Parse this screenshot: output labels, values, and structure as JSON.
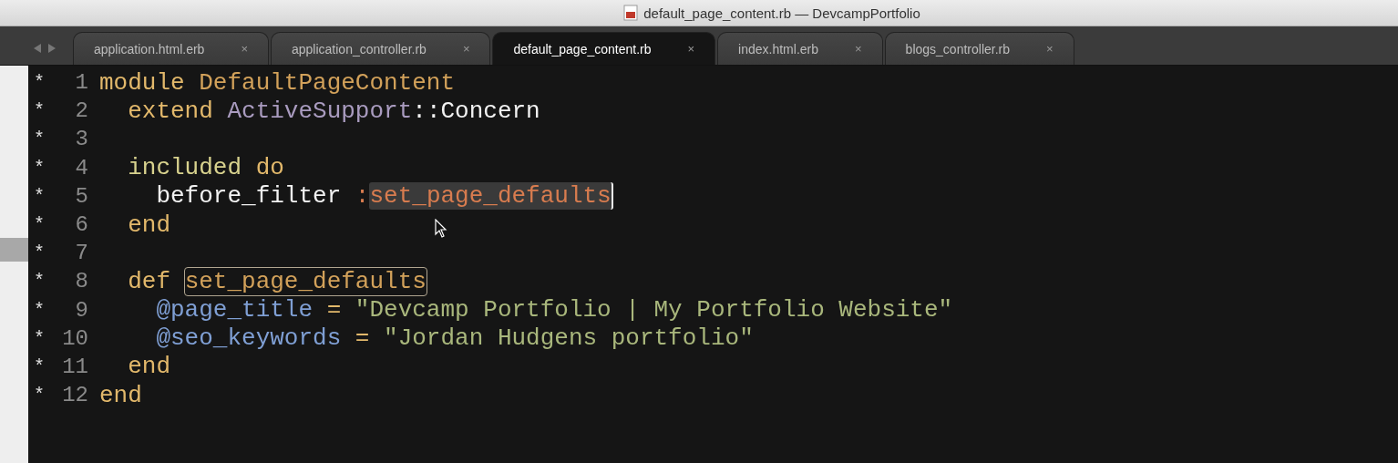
{
  "window": {
    "title": "default_page_content.rb — DevcampPortfolio"
  },
  "tabs": [
    {
      "label": "application.html.erb",
      "close": "×",
      "selected": false
    },
    {
      "label": "application_controller.rb",
      "close": "×",
      "selected": false
    },
    {
      "label": "default_page_content.rb",
      "close": "×",
      "selected": true
    },
    {
      "label": "index.html.erb",
      "close": "×",
      "selected": false
    },
    {
      "label": "blogs_controller.rb",
      "close": "×",
      "selected": false
    }
  ],
  "editor": {
    "lines": [
      {
        "marker": "*",
        "number": "1",
        "tokens": [
          {
            "kind": "keyword",
            "text": "module "
          },
          {
            "kind": "constant",
            "text": "DefaultPageContent"
          }
        ]
      },
      {
        "marker": "*",
        "number": "2",
        "tokens": [
          {
            "kind": "keyword",
            "text": "  extend "
          },
          {
            "kind": "module",
            "text": "ActiveSupport"
          },
          {
            "kind": "plain",
            "text": "::Concern"
          }
        ]
      },
      {
        "marker": "*",
        "number": "3"
      },
      {
        "marker": "*",
        "number": "4",
        "tokens": [
          {
            "kind": "method",
            "text": "  included "
          },
          {
            "kind": "keyword",
            "text": "do"
          }
        ]
      },
      {
        "marker": "*",
        "number": "5",
        "tokens": [
          {
            "kind": "plain",
            "text": "    before_filter "
          },
          {
            "kind": "symbol",
            "text": ":"
          },
          {
            "kind": "symbol",
            "text": "set_page_defaults",
            "selected": true
          }
        ]
      },
      {
        "marker": "*",
        "number": "6",
        "tokens": [
          {
            "kind": "keyword",
            "text": "  end"
          }
        ]
      },
      {
        "marker": "*",
        "number": "7"
      },
      {
        "marker": "*",
        "number": "8",
        "tokens": [
          {
            "kind": "keyword",
            "text": "  def "
          },
          {
            "kind": "constant",
            "text": "set_page_defaults",
            "boxed": true
          }
        ]
      },
      {
        "marker": "*",
        "number": "9",
        "tokens": [
          {
            "kind": "ivar",
            "text": "    @page_title"
          },
          {
            "kind": "keyword",
            "text": " = "
          },
          {
            "kind": "string",
            "text": "\"Devcamp Portfolio | My Portfolio Website\""
          }
        ]
      },
      {
        "marker": "*",
        "number": "10",
        "tokens": [
          {
            "kind": "ivar",
            "text": "    @seo_keywords"
          },
          {
            "kind": "keyword",
            "text": " = "
          },
          {
            "kind": "string",
            "text": "\"Jordan Hudgens portfolio\""
          }
        ]
      },
      {
        "marker": "*",
        "number": "11",
        "tokens": [
          {
            "kind": "keyword",
            "text": "  end"
          }
        ]
      },
      {
        "marker": "*",
        "number": "12",
        "tokens": [
          {
            "kind": "keyword",
            "text": "end"
          }
        ]
      }
    ]
  }
}
